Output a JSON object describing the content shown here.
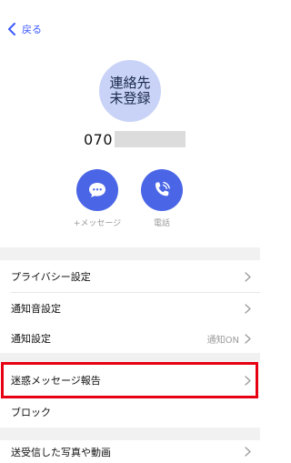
{
  "nav": {
    "back_label": "戻る"
  },
  "contact": {
    "avatar_line1": "連絡先",
    "avatar_line2": "未登録",
    "phone_prefix": "070"
  },
  "actions": [
    {
      "label": "+メッセージ",
      "icon": "chat-bubble-icon"
    },
    {
      "label": "電話",
      "icon": "phone-call-icon"
    }
  ],
  "settings": [
    {
      "label": "プライバシー設定",
      "value": ""
    },
    {
      "label": "通知音設定",
      "value": ""
    },
    {
      "label": "通知設定",
      "value": "通知ON"
    }
  ],
  "safety": [
    {
      "label": "迷惑メッセージ報告"
    },
    {
      "label": "ブロック"
    }
  ],
  "media": [
    {
      "label": "送受信した写真や動画"
    }
  ],
  "colors": {
    "accent": "#4a66e6",
    "avatar_bg": "#c9d3f7",
    "highlight": "#e60012"
  }
}
